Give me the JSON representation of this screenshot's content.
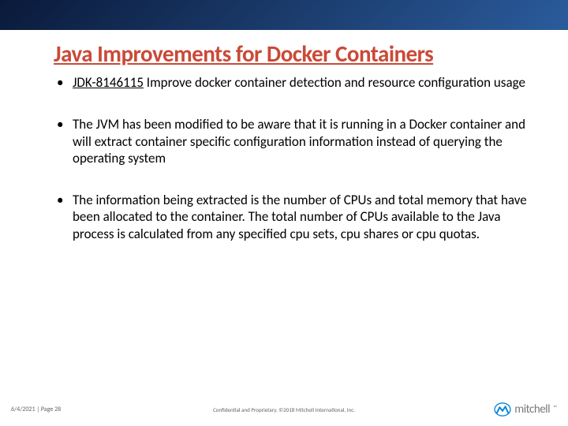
{
  "header": {
    "title": "Java Improvements for Docker Containers"
  },
  "bullets": [
    {
      "link_text": "JDK-8146115",
      "rest": " Improve docker container detection and resource configuration usage"
    },
    {
      "text": "The JVM has been modified to be aware that it is running in a Docker container and will extract container specific configuration information instead of querying the operating system"
    },
    {
      "text": "The information being extracted is the number of CPUs and total memory that have been allocated to the container. The total number of CPUs available to the Java process is calculated from any specified cpu sets, cpu shares or cpu quotas."
    }
  ],
  "footer": {
    "date": "6/4/2021",
    "page_sep": " | ",
    "page_label": "Page 28",
    "confidential": "Confidential and Proprietary. ©2018 Mitchell International, Inc.",
    "logo_text": "mitchell"
  }
}
